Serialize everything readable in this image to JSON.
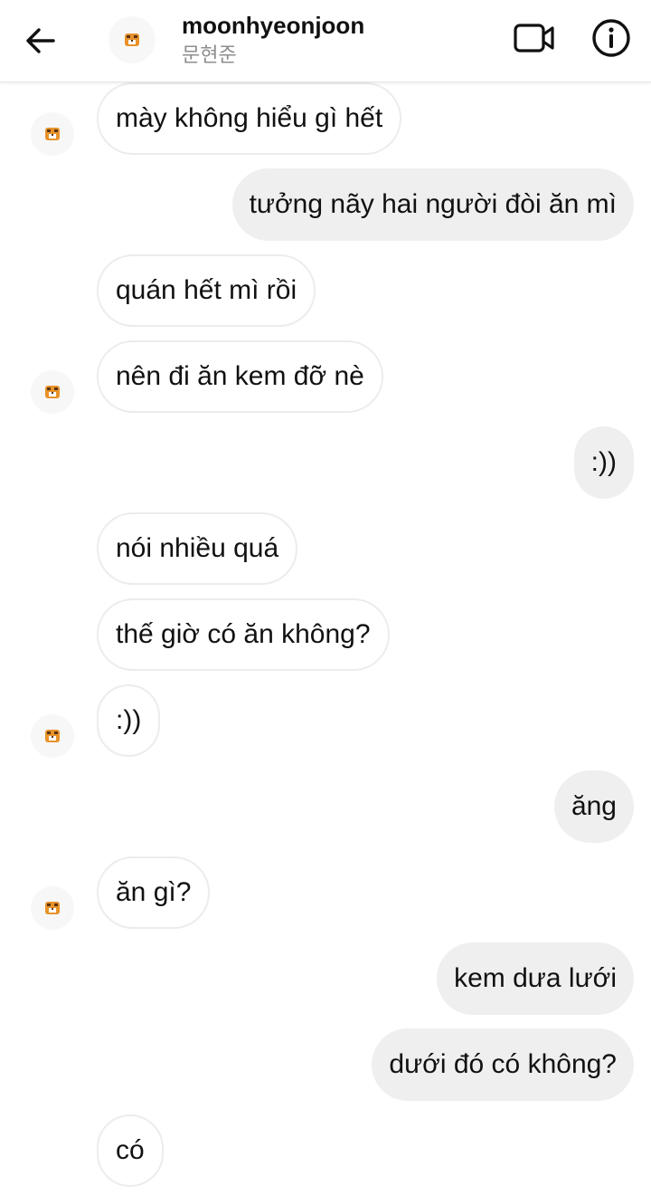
{
  "header": {
    "name": "moonhyeonjoon",
    "subtitle": "문현준",
    "back_icon": "arrow-left-icon",
    "video_icon": "video-camera-icon",
    "info_icon": "info-circle-icon",
    "avatar_icon": "tiger-avatar-icon"
  },
  "messages": [
    {
      "side": "in",
      "text": "mày không hiểu gì hết"
    },
    {
      "side": "out",
      "text": "tưởng nãy hai người đòi ăn mì"
    },
    {
      "side": "in",
      "text": "quán hết mì rồi"
    },
    {
      "side": "in",
      "text": "nên đi ăn kem đỡ nè"
    },
    {
      "side": "out",
      "text": ":))"
    },
    {
      "side": "in",
      "text": "nói nhiều quá"
    },
    {
      "side": "in",
      "text": "thế giờ có ăn không?"
    },
    {
      "side": "in",
      "text": ":))"
    },
    {
      "side": "out",
      "text": "ăng"
    },
    {
      "side": "in",
      "text": "ăn gì?"
    },
    {
      "side": "out",
      "text": "kem dưa lưới"
    },
    {
      "side": "out",
      "text": "dưới đó có không?"
    },
    {
      "side": "in",
      "text": "có"
    }
  ],
  "colors": {
    "incoming_bg": "#ffffff",
    "incoming_border": "#ececec",
    "outgoing_bg": "#efefef",
    "subtitle": "#8e8e8e"
  }
}
